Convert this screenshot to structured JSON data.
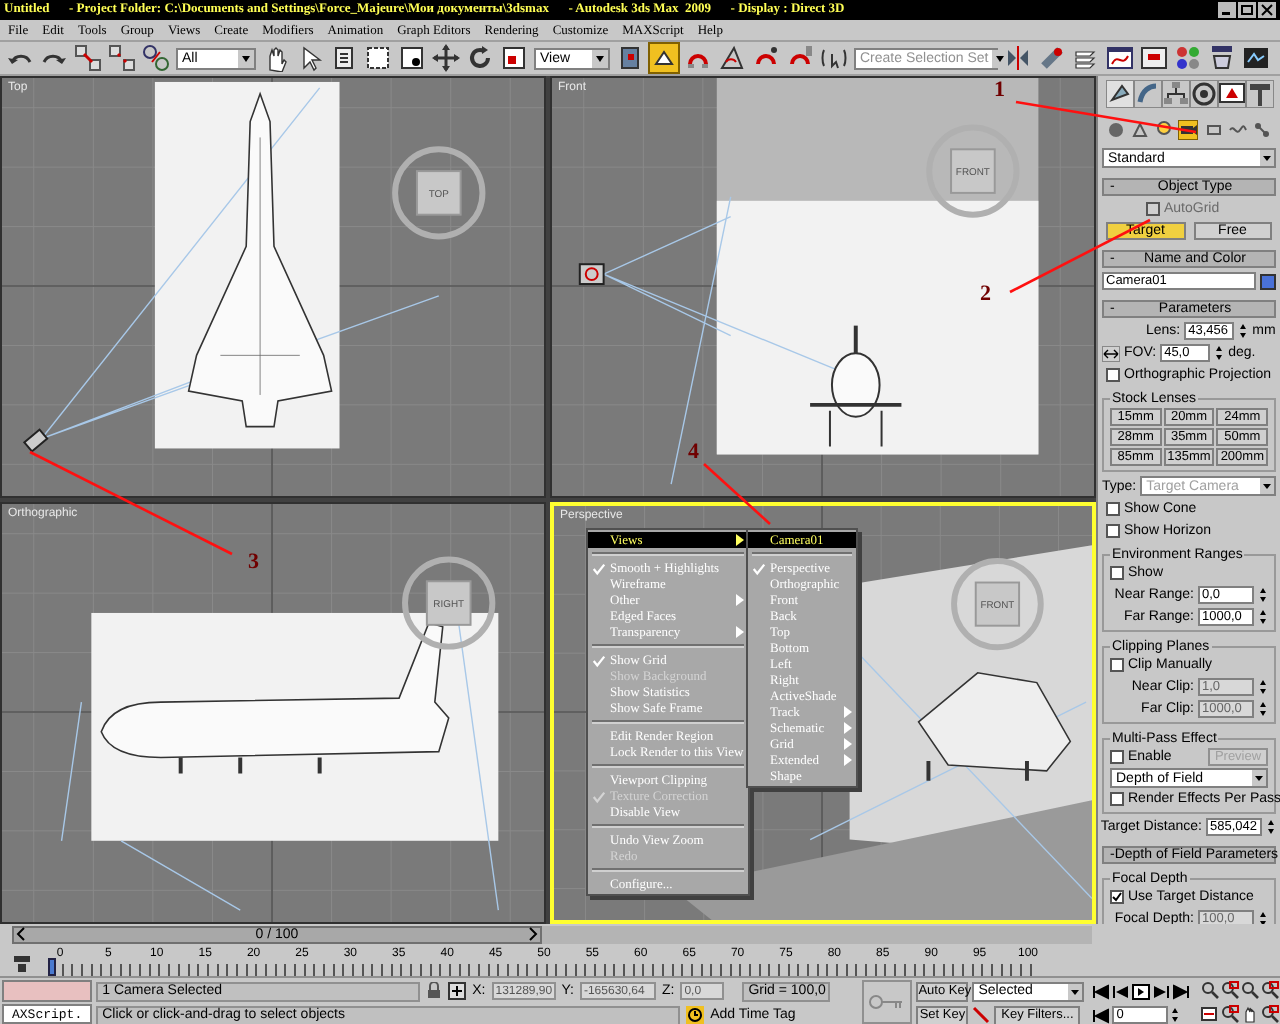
{
  "title_bar": {
    "title": "Untitled      - Project Folder: C:\\Documents and Settings\\Force_Majeure\\Мои документы\\3dsmax      - Autodesk 3ds Max  2009      - Display : Direct 3D"
  },
  "menu": [
    "File",
    "Edit",
    "Tools",
    "Group",
    "Views",
    "Create",
    "Modifiers",
    "Animation",
    "Graph Editors",
    "Rendering",
    "Customize",
    "MAXScript",
    "Help"
  ],
  "toolbar": {
    "selection_filter": "All",
    "coordinate_system": "View",
    "selection_set_placeholder": "Create Selection Set",
    "manipulate_on": true
  },
  "viewports": [
    {
      "label": "Top",
      "cube": "TOP",
      "active": false
    },
    {
      "label": "Front",
      "cube": "FRONT",
      "active": false
    },
    {
      "label": "Orthographic",
      "cube": "RIGHT",
      "active": false
    },
    {
      "label": "Perspective",
      "cube": "FRONT",
      "active": true
    }
  ],
  "viewport_menu": {
    "groups": [
      [
        {
          "label": "Views",
          "checked": false,
          "disabled": false,
          "submenu": true,
          "highlighted": true
        }
      ],
      [
        {
          "label": "Smooth + Highlights",
          "checked": true,
          "disabled": false,
          "submenu": false,
          "highlighted": false
        },
        {
          "label": "Wireframe",
          "checked": false,
          "disabled": false,
          "submenu": false,
          "highlighted": false
        },
        {
          "label": "Other",
          "checked": false,
          "disabled": false,
          "submenu": true,
          "highlighted": false
        },
        {
          "label": "Edged Faces",
          "checked": false,
          "disabled": false,
          "submenu": false,
          "highlighted": false
        },
        {
          "label": "Transparency",
          "checked": false,
          "disabled": false,
          "submenu": true,
          "highlighted": false
        }
      ],
      [
        {
          "label": "Show Grid",
          "checked": true,
          "disabled": false,
          "submenu": false,
          "highlighted": false
        },
        {
          "label": "Show Background",
          "checked": false,
          "disabled": true,
          "submenu": false,
          "highlighted": false
        },
        {
          "label": "Show Statistics",
          "checked": false,
          "disabled": false,
          "submenu": false,
          "highlighted": false
        },
        {
          "label": "Show Safe Frame",
          "checked": false,
          "disabled": false,
          "submenu": false,
          "highlighted": false
        }
      ],
      [
        {
          "label": "Edit Render Region",
          "checked": false,
          "disabled": false,
          "submenu": false,
          "highlighted": false
        },
        {
          "label": "Lock Render to this View",
          "checked": false,
          "disabled": false,
          "submenu": false,
          "highlighted": false
        }
      ],
      [
        {
          "label": "Viewport Clipping",
          "checked": false,
          "disabled": false,
          "submenu": false,
          "highlighted": false
        },
        {
          "label": "Texture Correction",
          "checked": true,
          "disabled": true,
          "submenu": false,
          "highlighted": false
        },
        {
          "label": "Disable View",
          "checked": false,
          "disabled": false,
          "submenu": false,
          "highlighted": false
        }
      ],
      [
        {
          "label": "Undo View Zoom",
          "checked": false,
          "disabled": false,
          "submenu": false,
          "highlighted": false
        },
        {
          "label": "Redo",
          "checked": false,
          "disabled": true,
          "submenu": false,
          "highlighted": false
        }
      ],
      [
        {
          "label": "Configure...",
          "checked": false,
          "disabled": false,
          "submenu": false,
          "highlighted": false
        }
      ]
    ],
    "submenu": {
      "groups": [
        [
          {
            "label": "Camera01",
            "checked": false,
            "disabled": false,
            "submenu": false,
            "highlighted": true
          }
        ],
        [
          {
            "label": "Perspective",
            "checked": true,
            "disabled": false,
            "submenu": false,
            "highlighted": false
          },
          {
            "label": "Orthographic",
            "checked": false,
            "disabled": false,
            "submenu": false,
            "highlighted": false
          },
          {
            "label": "Front",
            "checked": false,
            "disabled": false,
            "submenu": false,
            "highlighted": false
          },
          {
            "label": "Back",
            "checked": false,
            "disabled": false,
            "submenu": false,
            "highlighted": false
          },
          {
            "label": "Top",
            "checked": false,
            "disabled": false,
            "submenu": false,
            "highlighted": false
          },
          {
            "label": "Bottom",
            "checked": false,
            "disabled": false,
            "submenu": false,
            "highlighted": false
          },
          {
            "label": "Left",
            "checked": false,
            "disabled": false,
            "submenu": false,
            "highlighted": false
          },
          {
            "label": "Right",
            "checked": false,
            "disabled": false,
            "submenu": false,
            "highlighted": false
          },
          {
            "label": "ActiveShade",
            "checked": false,
            "disabled": false,
            "submenu": false,
            "highlighted": false
          },
          {
            "label": "Track",
            "checked": false,
            "disabled": false,
            "submenu": true,
            "highlighted": false
          },
          {
            "label": "Schematic",
            "checked": false,
            "disabled": false,
            "submenu": true,
            "highlighted": false
          },
          {
            "label": "Grid",
            "checked": false,
            "disabled": false,
            "submenu": true,
            "highlighted": false
          },
          {
            "label": "Extended",
            "checked": false,
            "disabled": false,
            "submenu": true,
            "highlighted": false
          },
          {
            "label": "Shape",
            "checked": false,
            "disabled": false,
            "submenu": false,
            "highlighted": false
          }
        ]
      ]
    }
  },
  "annotations": [
    {
      "label": "1"
    },
    {
      "label": "2"
    },
    {
      "label": "3"
    },
    {
      "label": "4"
    }
  ],
  "command_panel": {
    "category": "Standard",
    "object_type": {
      "sign": "-",
      "title": "Object Type",
      "autogrid": {
        "label": "AutoGrid",
        "checked": false,
        "disabled": true
      },
      "buttons": [
        {
          "label": "Target",
          "selected": true
        },
        {
          "label": "Free",
          "selected": false
        }
      ]
    },
    "name_and_color": {
      "sign": "-",
      "title": "Name and Color",
      "name": "Camera01"
    },
    "parameters": {
      "sign": "-",
      "title": "Parameters",
      "lens": {
        "label": "Lens:",
        "value": "43,456",
        "unit": "mm"
      },
      "fov": {
        "label": "FOV:",
        "value": "45,0",
        "unit": "deg."
      },
      "orthographic": {
        "label": "Orthographic Projection",
        "checked": false,
        "disabled": false
      },
      "stock_lenses": {
        "title": "Stock Lenses",
        "lenses": [
          "15mm",
          "20mm",
          "24mm",
          "28mm",
          "35mm",
          "50mm",
          "85mm",
          "135mm",
          "200mm"
        ]
      },
      "type": {
        "label": "Type:",
        "value": "Target Camera",
        "disabled": true
      },
      "show_cone": {
        "label": "Show Cone",
        "checked": false,
        "disabled": false
      },
      "show_horizon": {
        "label": "Show Horizon",
        "checked": false,
        "disabled": false
      },
      "environment_ranges": {
        "title": "Environment Ranges",
        "show": {
          "label": "Show",
          "checked": false,
          "disabled": false
        },
        "fields": [
          {
            "label": "Near Range:",
            "value": "0,0",
            "disabled": false
          },
          {
            "label": "Far Range:",
            "value": "1000,0",
            "disabled": false
          }
        ]
      },
      "clipping_planes": {
        "title": "Clipping Planes",
        "clip_manually": {
          "label": "Clip Manually",
          "checked": false,
          "disabled": false
        },
        "fields": [
          {
            "label": "Near Clip:",
            "value": "1,0",
            "disabled": true
          },
          {
            "label": "Far Clip:",
            "value": "1000,0",
            "disabled": true
          }
        ]
      },
      "multi_pass": {
        "title": "Multi-Pass Effect",
        "enable": {
          "label": "Enable",
          "checked": false,
          "disabled": false
        },
        "preview": {
          "label": "Preview",
          "disabled": true
        },
        "effect": "Depth of Field",
        "render_effects": {
          "label": "Render Effects Per Pass",
          "checked": false,
          "disabled": false
        }
      },
      "target_distance": {
        "label": "Target Distance:",
        "value": "585,042",
        "disabled": false
      }
    },
    "dof": {
      "sign": "-",
      "title": "Depth of Field Parameters",
      "focal_depth": {
        "title": "Focal Depth",
        "use_target": {
          "label": "Use Target Distance",
          "checked": true,
          "disabled": false
        },
        "field": {
          "label": "Focal Depth:",
          "value": "100,0",
          "disabled": true
        }
      }
    }
  },
  "time_slider": {
    "position": "0 / 100",
    "level": 0
  },
  "track_bar": {
    "ticks": [
      "0",
      "5",
      "10",
      "15",
      "20",
      "25",
      "30",
      "35",
      "40",
      "45",
      "50",
      "55",
      "60",
      "65",
      "70",
      "75",
      "80",
      "85",
      "90",
      "95",
      "100"
    ]
  },
  "status_bar": {
    "listener": "AXScript.",
    "selection": "1 Camera Selected",
    "prompt": "Click or click-and-drag to select objects",
    "x": {
      "label": "X:",
      "value": "131289,90"
    },
    "y": {
      "label": "Y:",
      "value": "-165630,64"
    },
    "z": {
      "label": "Z:",
      "value": "0,0"
    },
    "grid": "Grid = 100,0",
    "time_tag": "Add Time Tag",
    "auto_key": "Auto Key",
    "set_key": "Set Key",
    "key_mode": "Selected",
    "key_filters": "Key Filters...",
    "frame": "0"
  }
}
